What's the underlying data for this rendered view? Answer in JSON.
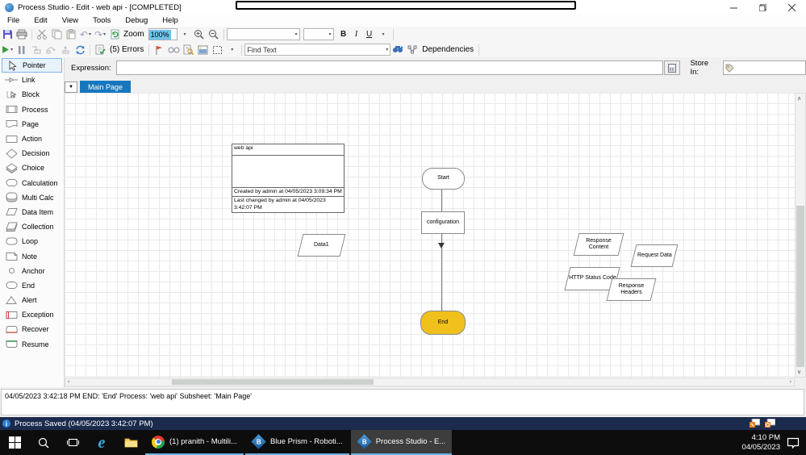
{
  "window": {
    "title": "Process Studio  - Edit - web api - [COMPLETED]"
  },
  "menu": {
    "items": [
      {
        "label": "File"
      },
      {
        "label": "Edit"
      },
      {
        "label": "View"
      },
      {
        "label": "Tools"
      },
      {
        "label": "Debug"
      },
      {
        "label": "Help"
      }
    ]
  },
  "toolbar": {
    "zoom_label": "Zoom",
    "zoom_value": "100%",
    "bold": "B",
    "italic": "I",
    "underline": "U",
    "errors_label": "(5) Errors",
    "find_text_value": "Find Text",
    "dependencies_label": "Dependencies"
  },
  "expression": {
    "label": "Expression:",
    "value": "",
    "store_in_label": "Store In:",
    "store_in_value": ""
  },
  "sidebar": {
    "items": [
      {
        "label": "Pointer",
        "selected": true
      },
      {
        "label": "Link"
      },
      {
        "label": "Block"
      },
      {
        "label": "Process"
      },
      {
        "label": "Page"
      },
      {
        "label": "Action"
      },
      {
        "label": "Decision"
      },
      {
        "label": "Choice"
      },
      {
        "label": "Calculation"
      },
      {
        "label": "Multi Calc"
      },
      {
        "label": "Data Item"
      },
      {
        "label": "Collection"
      },
      {
        "label": "Loop"
      },
      {
        "label": "Note"
      },
      {
        "label": "Anchor"
      },
      {
        "label": "End"
      },
      {
        "label": "Alert"
      },
      {
        "label": "Exception"
      },
      {
        "label": "Recover"
      },
      {
        "label": "Resume"
      }
    ]
  },
  "canvas": {
    "tab_label": "Main Page"
  },
  "flowchart": {
    "note": {
      "title": "web api",
      "created": "Created by admin at 04/05/2023  3:09:34 PM",
      "last_changed": "Last changed by admin at 04/05/2023 3:42:07 PM"
    },
    "start_label": "Start",
    "action_label": "configuration",
    "end_label": "End",
    "data_items": [
      {
        "label": "Data1"
      },
      {
        "label": "Response Content"
      },
      {
        "label": "Request Data"
      },
      {
        "label": "HTTP Status Code"
      },
      {
        "label": "Response Headers"
      }
    ]
  },
  "log": {
    "text": "04/05/2023 3:42:18 PM END: 'End' Process: 'web api' Subsheet: 'Main Page'"
  },
  "status": {
    "text": "Process Saved (04/05/2023 3:42:07 PM)"
  },
  "taskbar": {
    "apps": [
      {
        "label": "(1) pranith - Multili..."
      },
      {
        "label": "Blue Prism - Roboti..."
      },
      {
        "label": "Process Studio  - E..."
      }
    ],
    "time": "4:10 PM",
    "date": "04/05/2023"
  },
  "colors": {
    "accent_blue": "#1777bd",
    "end_node_fill": "#f0c01c",
    "status_bar": "#1b2b4d",
    "taskbar_underline": "#6ab1e0"
  }
}
